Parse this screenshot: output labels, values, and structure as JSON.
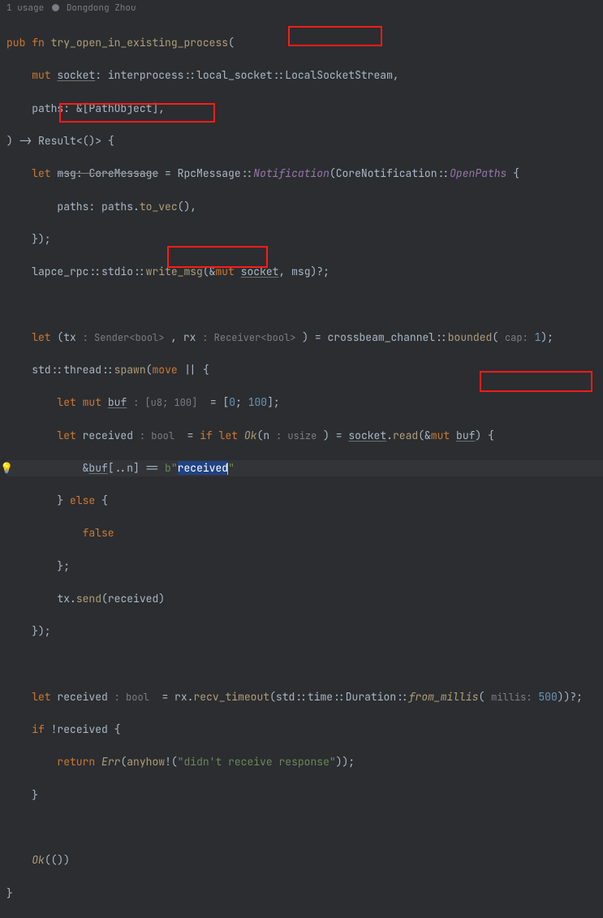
{
  "header": {
    "usage": "1 usage",
    "author": "Dongdong Zhou"
  },
  "tokens": {
    "pub": "pub",
    "fn": "fn",
    "mut": "mut",
    "let": "let",
    "if": "if",
    "else": "else",
    "return": "return",
    "move": "move",
    "false": "false",
    "fn_name": "try_open_in_existing_process",
    "socket": "socket",
    "interprocess": "interprocess",
    "local_socket": "local_socket",
    "LocalSocketStream": "LocalSocketStream",
    "paths": "paths",
    "PathObject": "PathObject",
    "Result": "Result",
    "msg": "msg",
    "CoreMessage": "CoreMessage",
    "RpcMessage": "RpcMessage",
    "Notification": "Notification",
    "CoreNotification": "CoreNotification",
    "OpenPaths": "OpenPaths",
    "to_vec": "to_vec",
    "lapce_rpc": "lapce_rpc",
    "stdio": "stdio",
    "write_msg": "write_msg",
    "tx": "tx",
    "rx": "rx",
    "Sender_hint": ": Sender<bool>",
    "Receiver_hint": ": Receiver<bool>",
    "crossbeam_channel": "crossbeam_channel",
    "bounded": "bounded",
    "cap_hint": "cap:",
    "cap_val": "1",
    "std": "std",
    "thread": "thread",
    "spawn": "spawn",
    "buf": "buf",
    "buf_hint": ": [u8; 100]",
    "arr_0": "0",
    "arr_100": "100",
    "received": "received",
    "bool_hint": ": bool",
    "Ok": "Ok",
    "n": "n",
    "usize_hint": ": usize",
    "read": "read",
    "b_prefix": "b",
    "received_str": "received",
    "quote": "\"",
    "send": "send",
    "recv_timeout": "recv_timeout",
    "time": "time",
    "Duration": "Duration",
    "from_millis": "from_millis",
    "millis_hint": "millis:",
    "millis_val": "500",
    "Err": "Err",
    "anyhow": "anyhow",
    "err_str": "\"didn't receive response\"",
    "Ok_fn": "Ok"
  }
}
